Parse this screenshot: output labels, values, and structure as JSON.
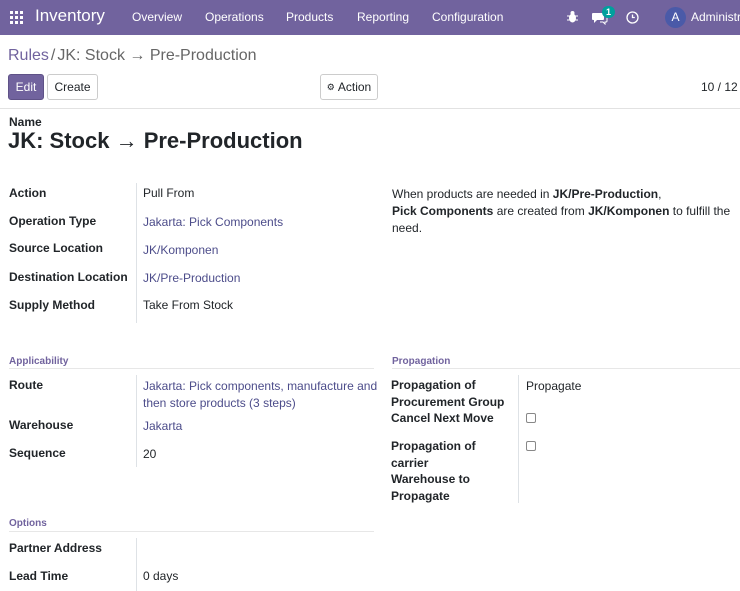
{
  "navbar": {
    "app_name": "Inventory",
    "menu": [
      "Overview",
      "Operations",
      "Products",
      "Reporting",
      "Configuration"
    ],
    "message_count": "1",
    "avatar_initial": "A",
    "user_name": "Administrator",
    "bg_color": "#71639e"
  },
  "breadcrumb": {
    "parent": "Rules",
    "separator": "/",
    "current": "JK: Stock → Pre-Production"
  },
  "toolbar": {
    "edit_label": "Edit",
    "create_label": "Create",
    "action_label": "Action",
    "pager": "10 / 12"
  },
  "form": {
    "name_label": "Name",
    "name_value": "JK: Stock → Pre-Production",
    "fields": {
      "action": {
        "label": "Action",
        "value": "Pull From"
      },
      "operation_type": {
        "label": "Operation Type",
        "value": "Jakarta: Pick Components"
      },
      "source_location": {
        "label": "Source Location",
        "value": "JK/Komponen"
      },
      "destination_location": {
        "label": "Destination Location",
        "value": "JK/Pre-Production"
      },
      "supply_method": {
        "label": "Supply Method",
        "value": "Take From Stock"
      }
    },
    "help": {
      "p1": "When products are needed in ",
      "b1": "JK/Pre-Production",
      "p2": ",",
      "b2": "Pick Components",
      "p3": " are created from ",
      "b3": "JK/Komponen",
      "p4": " to fulfill the need."
    },
    "applicability": {
      "title": "Applicability",
      "route_label": "Route",
      "route_value_line1": "Jakarta: Pick components, manufacture and",
      "route_value_line2": "then store products (3 steps)",
      "warehouse_label": "Warehouse",
      "warehouse_value": "Jakarta",
      "sequence_label": "Sequence",
      "sequence_value": "20"
    },
    "propagation": {
      "title": "Propagation",
      "group_label_line1": "Propagation of",
      "group_label_line2": "Procurement Group",
      "group_value": "Propagate",
      "cancel_label": "Cancel Next Move",
      "cancel_checked": false,
      "carrier_label_line1": "Propagation of",
      "carrier_label_line2": "carrier",
      "carrier_checked": false,
      "warehouse_label_line1": "Warehouse to",
      "warehouse_label_line2": "Propagate",
      "warehouse_value": ""
    },
    "options": {
      "title": "Options",
      "partner_label": "Partner Address",
      "partner_value": "",
      "lead_label": "Lead Time",
      "lead_value": "0 days"
    }
  }
}
